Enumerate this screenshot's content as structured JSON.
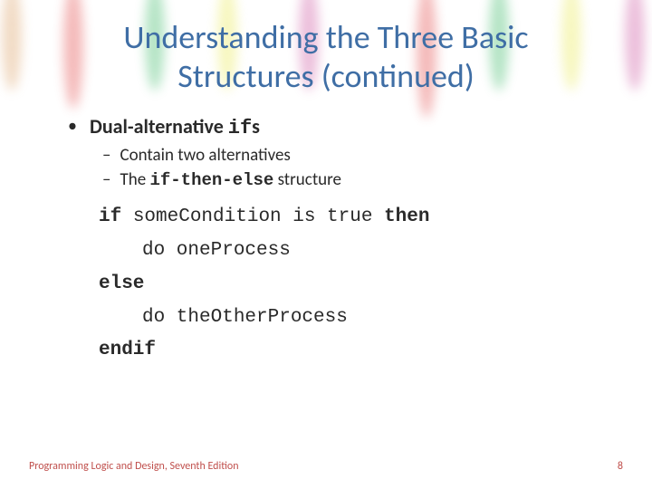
{
  "title": "Understanding the Three Basic Structures (continued)",
  "bullet_main_prefix": "Dual-alternative ",
  "bullet_main_code": "if",
  "bullet_main_suffix": "s",
  "sub1": "Contain two alternatives",
  "sub2_prefix": "The ",
  "sub2_code": "if-then-else",
  "sub2_suffix": " structure",
  "code": {
    "l1_kw1": "if",
    "l1_mid": " someCondition is true ",
    "l1_kw2": "then",
    "l2": "do oneProcess",
    "l3_kw": "else",
    "l4": "do theOtherProcess",
    "l5_kw": "endif"
  },
  "footer_text": "Programming Logic and Design, Seventh Edition",
  "page_number": "8"
}
